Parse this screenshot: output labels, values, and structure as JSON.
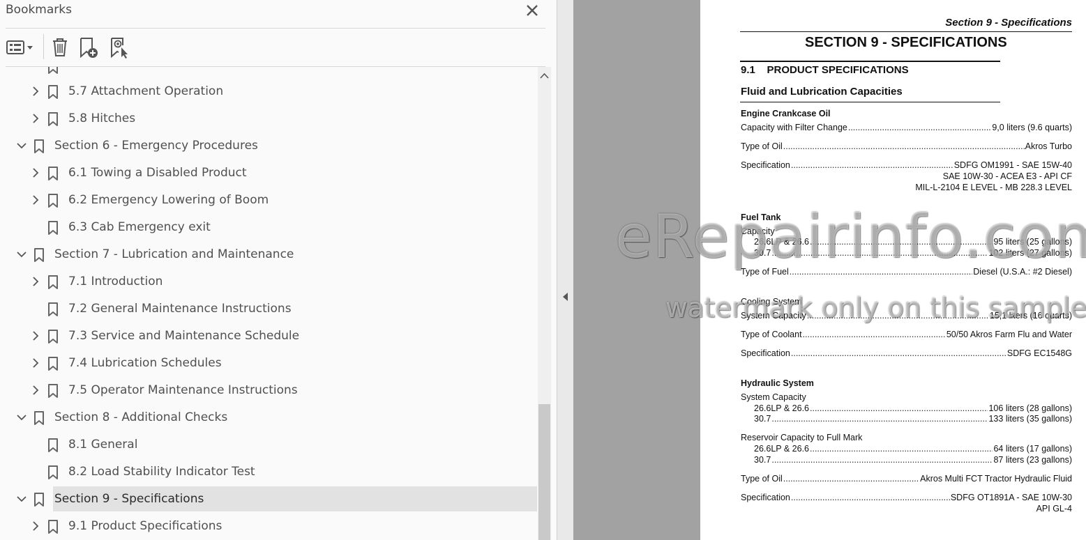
{
  "panel": {
    "title": "Bookmarks"
  },
  "toolbar": {
    "items": [
      {
        "name": "options-menu-icon"
      },
      {
        "name": "delete-bookmark-icon"
      },
      {
        "name": "new-bookmark-icon"
      },
      {
        "name": "new-bookmark-from-selection-icon"
      }
    ]
  },
  "bookmarks": [
    {
      "label": "5.7 Attachment Operation",
      "level": 2,
      "toggle": "collapsed",
      "selected": false
    },
    {
      "label": "5.8 Hitches",
      "level": 2,
      "toggle": "collapsed",
      "selected": false
    },
    {
      "label": "Section 6 - Emergency Procedures",
      "level": 1,
      "toggle": "expanded",
      "selected": false
    },
    {
      "label": "6.1 Towing a Disabled Product",
      "level": 2,
      "toggle": "collapsed",
      "selected": false
    },
    {
      "label": "6.2 Emergency Lowering of Boom",
      "level": 2,
      "toggle": "collapsed",
      "selected": false
    },
    {
      "label": "6.3 Cab Emergency exit",
      "level": 2,
      "toggle": "none",
      "selected": false
    },
    {
      "label": "Section 7 - Lubrication and Maintenance",
      "level": 1,
      "toggle": "expanded",
      "selected": false
    },
    {
      "label": "7.1 Introduction",
      "level": 2,
      "toggle": "collapsed",
      "selected": false
    },
    {
      "label": "7.2 General Maintenance Instructions",
      "level": 2,
      "toggle": "none",
      "selected": false
    },
    {
      "label": "7.3 Service and Maintenance Schedule",
      "level": 2,
      "toggle": "collapsed",
      "selected": false
    },
    {
      "label": "7.4 Lubrication Schedules",
      "level": 2,
      "toggle": "collapsed",
      "selected": false
    },
    {
      "label": "7.5 Operator Maintenance Instructions",
      "level": 2,
      "toggle": "collapsed",
      "selected": false
    },
    {
      "label": "Section 8 - Additional Checks",
      "level": 1,
      "toggle": "expanded",
      "selected": false
    },
    {
      "label": "8.1 General",
      "level": 2,
      "toggle": "none",
      "selected": false
    },
    {
      "label": "8.2 Load Stability Indicator Test",
      "level": 2,
      "toggle": "none",
      "selected": false
    },
    {
      "label": "Section 9 - Specifications",
      "level": 1,
      "toggle": "expanded",
      "selected": true
    },
    {
      "label": "9.1 Product Specifications",
      "level": 2,
      "toggle": "collapsed",
      "selected": false
    }
  ],
  "document": {
    "page_header": "Section 9 - Specifications",
    "title": "SECTION 9 - SPECIFICATIONS",
    "subsection": "9.1    PRODUCT SPECIFICATIONS",
    "subheading": "Fluid and Lubrication Capacities",
    "engine": {
      "heading": "Engine Crankcase Oil",
      "capacity_label": "Capacity with Filter Change",
      "capacity_value": "9,0 liters (9.6 quarts)",
      "type_label": "Type of Oil",
      "type_value": "Akros Turbo",
      "spec_label": "Specification",
      "spec_value": "SDFG OM1991 - SAE 15W-40",
      "spec_line2": "SAE 10W-30 - ACEA E3 - API CF",
      "spec_line3": "MIL-L-2104 E LEVEL - MB 228.3 LEVEL"
    },
    "fuel": {
      "heading": "Fuel Tank",
      "capacity_label": "Capacity",
      "row1_label": "26.6LP & 26.6",
      "row1_value": "95 liters (25 gallons)",
      "row2_label": "30.7",
      "row2_value": "102 liters (27 gallons)",
      "type_label": "Type of Fuel",
      "type_value": "Diesel (U.S.A.: #2 Diesel)"
    },
    "cooling": {
      "heading": "Cooling System",
      "capacity_label": "System Capacity",
      "capacity_value": "15,1 liters (16 quarts)",
      "coolant_label": "Type of Coolant",
      "coolant_value": "50/50 Akros Farm Flu and Water",
      "spec_label": "Specification",
      "spec_value": "SDFG EC1548G"
    },
    "hydraulic": {
      "heading": "Hydraulic System",
      "capacity_label": "System Capacity",
      "row1_label": "26.6LP & 26.6",
      "row1_value": "106 liters (28 gallons)",
      "row2_label": "30.7",
      "row2_value": "133 liters (35 gallons)",
      "reservoir_label": "Reservoir Capacity to Full Mark",
      "row3_label": "26.6LP & 26.6",
      "row3_value": "64 liters (17 gallons)",
      "row4_label": "30.7",
      "row4_value": "87 liters (23 gallons)",
      "type_label": "Type of Oil",
      "type_value": "Akros Multi FCT Tractor Hydraulic Fluid",
      "spec_label": "Specification",
      "spec_value": "SDFG OT1891A - SAE 10W-30",
      "spec_line2": "API GL-4"
    }
  },
  "watermark": {
    "line1": "eRepairinfo.com",
    "line2": "watermark only on this sample"
  },
  "colors": {
    "panel_bg": "#fafafa",
    "selected_row": "#e2e2e2",
    "gray_area": "#a2a2a2",
    "icon": "#555555"
  }
}
